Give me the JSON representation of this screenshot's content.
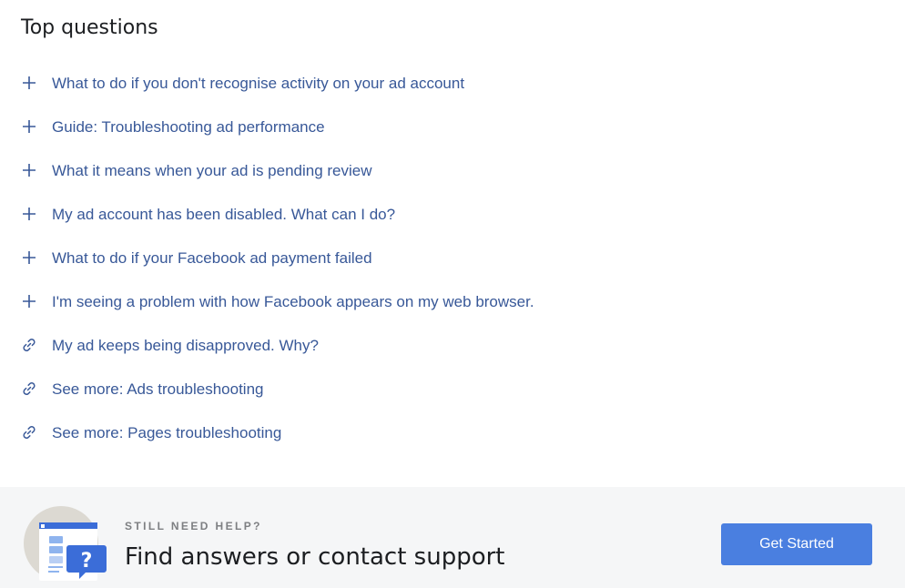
{
  "section": {
    "title": "Top questions"
  },
  "questions": [
    {
      "label": "What to do if you don't recognise activity on your ad account",
      "icon": "plus-icon"
    },
    {
      "label": "Guide: Troubleshooting ad performance",
      "icon": "plus-icon"
    },
    {
      "label": "What it means when your ad is pending review",
      "icon": "plus-icon"
    },
    {
      "label": "My ad account has been disabled. What can I do?",
      "icon": "plus-icon"
    },
    {
      "label": "What to do if your Facebook ad payment failed",
      "icon": "plus-icon"
    },
    {
      "label": "I'm seeing a problem with how Facebook appears on my web browser.",
      "icon": "plus-icon"
    },
    {
      "label": "My ad keeps being disapproved. Why?",
      "icon": "link-icon"
    },
    {
      "label": "See more: Ads troubleshooting",
      "icon": "link-icon"
    },
    {
      "label": "See more: Pages troubleshooting",
      "icon": "link-icon"
    }
  ],
  "help": {
    "kicker": "STILL NEED HELP?",
    "headline": "Find answers or contact support",
    "button_label": "Get Started",
    "illustration_icon": "help-question-icon"
  },
  "colors": {
    "link": "#385898",
    "button": "#4a7fe0",
    "band_background": "#f5f6f7"
  }
}
